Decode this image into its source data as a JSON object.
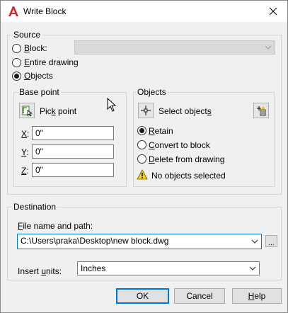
{
  "window": {
    "title": "Write Block"
  },
  "source": {
    "legend": "Source",
    "options": [
      {
        "label": "Block:",
        "checked": false
      },
      {
        "label": "Entire drawing",
        "checked": false
      },
      {
        "label": "Objects",
        "checked": true
      }
    ],
    "block_select_value": ""
  },
  "base_point": {
    "legend": "Base point",
    "pick_label": "Pick point",
    "coords": [
      {
        "label": "X:",
        "value": "0\""
      },
      {
        "label": "Y:",
        "value": "0\""
      },
      {
        "label": "Z:",
        "value": "0\""
      }
    ]
  },
  "objects": {
    "legend": "Objects",
    "select_label": "Select objects",
    "options": [
      {
        "label": "Retain",
        "checked": true
      },
      {
        "label": "Convert to block",
        "checked": false
      },
      {
        "label": "Delete from drawing",
        "checked": false
      }
    ],
    "status": "No objects selected"
  },
  "destination": {
    "legend": "Destination",
    "file_label": "File name and path:",
    "file_value": "C:\\Users\\praka\\Desktop\\new block.dwg",
    "browse_label": "...",
    "units_label": "Insert units:",
    "units_value": "Inches"
  },
  "buttons": {
    "ok": "OK",
    "cancel": "Cancel",
    "help": "Help"
  }
}
